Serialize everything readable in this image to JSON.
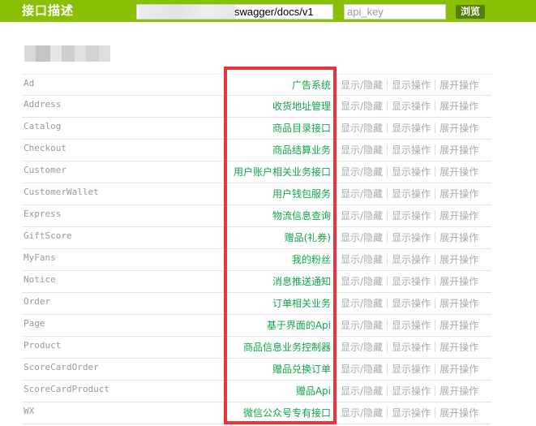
{
  "header": {
    "title": "接口描述",
    "url_value": "swagger/docs/v1",
    "api_key_placeholder": "api_key",
    "explore_label": "浏览"
  },
  "colors": {
    "header_bg": "#89bf04",
    "explore_bg": "#547f00",
    "description_text": "#10a54a",
    "highlight_border": "#e8343a"
  },
  "rows": [
    {
      "name": "Ad",
      "description": "广告系统"
    },
    {
      "name": "Address",
      "description": "收货地址管理"
    },
    {
      "name": "Catalog",
      "description": "商品目录接口"
    },
    {
      "name": "Checkout",
      "description": "商品结算业务"
    },
    {
      "name": "Customer",
      "description": "用户账户相关业务接口"
    },
    {
      "name": "CustomerWallet",
      "description": "用户钱包服务"
    },
    {
      "name": "Express",
      "description": "物流信息查询"
    },
    {
      "name": "GiftScore",
      "description": "赠品(礼券)"
    },
    {
      "name": "MyFans",
      "description": "我的粉丝"
    },
    {
      "name": "Notice",
      "description": "消息推送通知"
    },
    {
      "name": "Order",
      "description": "订单相关业务"
    },
    {
      "name": "Page",
      "description": "基于界面的Api"
    },
    {
      "name": "Product",
      "description": "商品信息业务控制器"
    },
    {
      "name": "ScoreCardOrder",
      "description": "赠品兑换订单"
    },
    {
      "name": "ScoreCardProduct",
      "description": "赠品Api"
    },
    {
      "name": "WX",
      "description": "微信公众号专有接口"
    }
  ],
  "row_actions": {
    "show_hide": "显示/隐藏",
    "list_operations": "显示操作",
    "expand_operations": "展开操作"
  }
}
